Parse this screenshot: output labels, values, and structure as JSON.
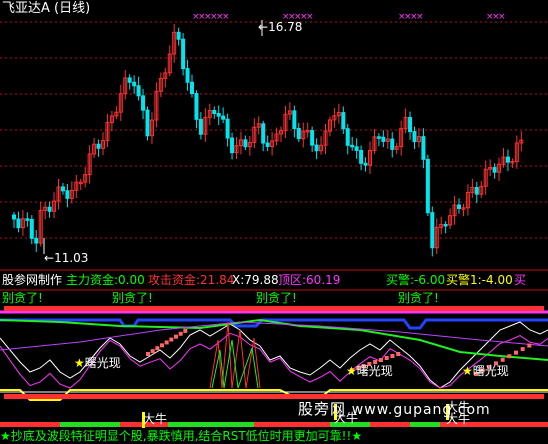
{
  "title": "飞亚达A (日线)",
  "price_high_label": "16.78",
  "price_low_label": "11.03",
  "indicator_bar": {
    "source": "股参网制作",
    "main_fund": "主力资金:0.00",
    "attack_fund": "攻击资金:21.84",
    "x_value": "X:79.88",
    "top_zone": "顶区:60.19",
    "buy_alert": "买警:-6.00",
    "buy_alert_1": "买警1:-4.00",
    "buy": "买"
  },
  "leave_labels": [
    "别贪了!",
    "别贪了!",
    "别贪了!",
    "别贪了!"
  ],
  "exposure_labels": [
    "曙光现",
    "曙光现",
    "曙光现"
  ],
  "bull_labels": [
    "大牛",
    "大牛",
    "大牛",
    "大牛"
  ],
  "watermark": {
    "cn": "股旁网",
    "url": "www.gupang.com"
  },
  "footer_text": "抄底及波段特征明显个股,暴跌慎用,结合RST低位时用更加可靠!!",
  "footer_star": "★",
  "colors": {
    "up": "#ff3030",
    "down": "#00e5ee",
    "grid": "#c01010",
    "leave": "#00ff00",
    "star": "#ffff00",
    "magenta": "#ff33ff",
    "green": "#00ff00",
    "white": "#ffffff"
  }
}
